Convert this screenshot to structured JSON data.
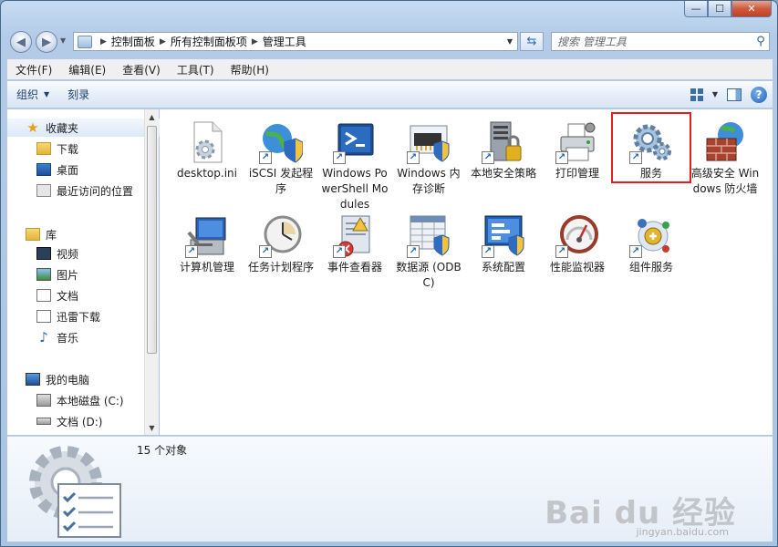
{
  "window": {
    "caption": {
      "min": "—",
      "max": "☐",
      "close": "✕"
    }
  },
  "nav": {
    "breadcrumbs": [
      "控制面板",
      "所有控制面板项",
      "管理工具"
    ],
    "search_placeholder": "搜索 管理工具"
  },
  "menu": [
    "文件(F)",
    "编辑(E)",
    "查看(V)",
    "工具(T)",
    "帮助(H)"
  ],
  "toolbar": {
    "organize": "组织",
    "burn": "刻录"
  },
  "sidebar": {
    "favorites": "收藏夹",
    "fav_items": [
      "下载",
      "桌面",
      "最近访问的位置"
    ],
    "library": "库",
    "lib_items": [
      "视频",
      "图片",
      "文档",
      "迅雷下载",
      "音乐"
    ],
    "computer": "我的电脑",
    "drives": [
      "本地磁盘 (C:)",
      "文档 (D:)"
    ]
  },
  "files": [
    {
      "label": "desktop.ini",
      "icon": "settings-file-icon",
      "shortcut": false
    },
    {
      "label": "iSCSI 发起程序",
      "icon": "globe-shield-icon",
      "shortcut": true
    },
    {
      "label": "Windows PowerShell Modules",
      "icon": "powershell-icon",
      "shortcut": true
    },
    {
      "label": "Windows 内存诊断",
      "icon": "memory-chip-icon",
      "shortcut": true
    },
    {
      "label": "本地安全策略",
      "icon": "server-lock-icon",
      "shortcut": true
    },
    {
      "label": "打印管理",
      "icon": "printer-icon",
      "shortcut": true
    },
    {
      "label": "服务",
      "icon": "gears-icon",
      "shortcut": true
    },
    {
      "label": "高级安全 Windows 防火墙",
      "icon": "firewall-icon",
      "shortcut": false
    },
    {
      "label": "计算机管理",
      "icon": "computer-management-icon",
      "shortcut": true
    },
    {
      "label": "任务计划程序",
      "icon": "clock-icon",
      "shortcut": true
    },
    {
      "label": "事件查看器",
      "icon": "event-log-icon",
      "shortcut": true
    },
    {
      "label": "数据源 (ODBC)",
      "icon": "database-icon",
      "shortcut": true
    },
    {
      "label": "系统配置",
      "icon": "system-config-icon",
      "shortcut": true
    },
    {
      "label": "性能监视器",
      "icon": "gauge-icon",
      "shortcut": true
    },
    {
      "label": "组件服务",
      "icon": "component-services-icon",
      "shortcut": true
    }
  ],
  "status": {
    "count_text": "15 个对象"
  },
  "watermark": {
    "main": "Bai du 经验",
    "sub": "jingyan.baidu.com"
  },
  "colors": {
    "highlight": "#e21e1e",
    "accent": "#2c6fb7"
  }
}
